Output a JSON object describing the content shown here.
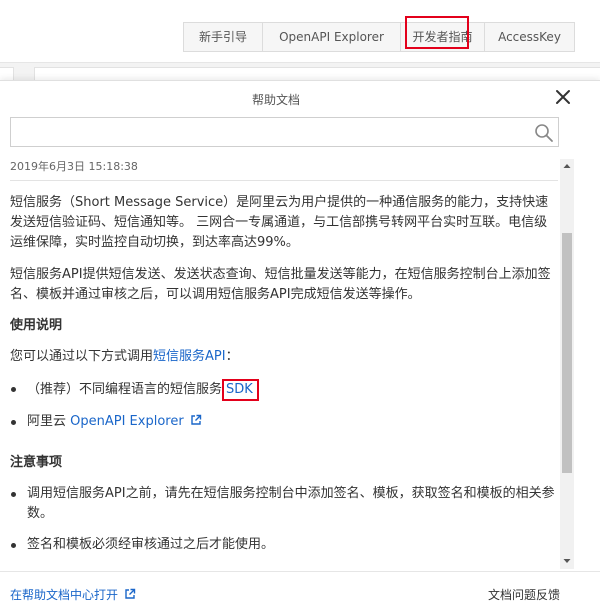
{
  "toolbar": {
    "tabs": [
      "新手引导",
      "OpenAPI Explorer",
      "开发者指南",
      "AccessKey"
    ]
  },
  "panel": {
    "title": "帮助文档",
    "search": {
      "placeholder": "",
      "value": ""
    }
  },
  "doc": {
    "date": "2019年6月3日 15:18:38",
    "intro1": "短信服务（Short Message Service）是阿里云为用户提供的一种通信服务的能力，支持快速发送短信验证码、短信通知等。 三网合一专属通道，与工信部携号转网平台实时互联。电信级运维保障，实时监控自动切换，到达率高达99%。",
    "intro2": "短信服务API提供短信发送、发送状态查询、短信批量发送等能力，在短信服务控制台上添加签名、模板并通过审核之后，可以调用短信服务API完成短信发送等操作。",
    "usage_heading": "使用说明",
    "usage_text": "您可以通过以下方式调用",
    "usage_link": "短信服务API",
    "usage_colon": "：",
    "usage_items": [
      {
        "prefix": "（推荐）不同编程语言的短信服务",
        "link": "SDK"
      },
      {
        "prefix": "阿里云 ",
        "link": "OpenAPI Explorer"
      }
    ],
    "notes_heading": "注意事项",
    "notes_items": [
      "调用短信服务API之前，请先在短信服务控制台中添加签名、模板，获取签名和模板的相关参数。",
      "签名和模板必须经审核通过之后才能使用。"
    ]
  },
  "footer": {
    "open_link": "在帮助文档中心打开",
    "feedback": "文档问题反馈"
  },
  "colors": {
    "link": "#1a66c9",
    "highlight": "#e3001b"
  }
}
